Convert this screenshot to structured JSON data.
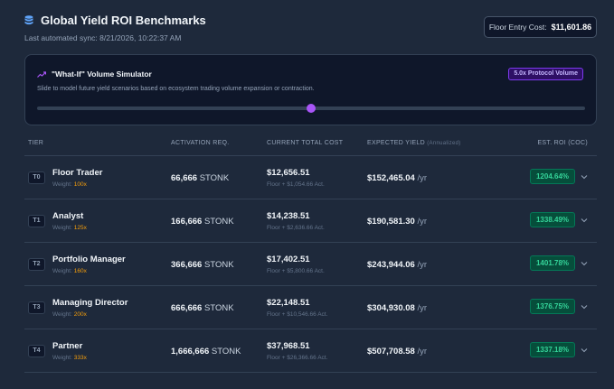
{
  "header": {
    "title": "Global Yield ROI Benchmarks",
    "sync": "Last automated sync: 8/21/2026, 10:22:37 AM"
  },
  "floor": {
    "label": "Floor Entry Cost:",
    "value": "$11,601.86"
  },
  "simulator": {
    "title": "\"What-If\" Volume Simulator",
    "description": "Slide to model future yield scenarios based on ecosystem trading volume expansion or contraction.",
    "badge": "5.0x Protocol Volume",
    "slider_fraction": 0.5
  },
  "table": {
    "headers": {
      "tier": "TIER",
      "activation": "ACTIVATION REQ.",
      "cost": "CURRENT TOTAL COST",
      "yield": "EXPECTED YIELD",
      "yield_sub": "(Annualized)",
      "roi": "EST. ROI (COC)"
    },
    "rows": [
      {
        "badge": "T0",
        "name": "Floor Trader",
        "weight_label": "Weight:",
        "weight": "100x",
        "activation": "66,666",
        "unit": "STONK",
        "cost": "$12,656.51",
        "cost_sub": "Floor + $1,054.66 Act.",
        "yield": "$152,465.04",
        "per": "/yr",
        "roi": "1204.64%"
      },
      {
        "badge": "T1",
        "name": "Analyst",
        "weight_label": "Weight:",
        "weight": "125x",
        "activation": "166,666",
        "unit": "STONK",
        "cost": "$14,238.51",
        "cost_sub": "Floor + $2,636.66 Act.",
        "yield": "$190,581.30",
        "per": "/yr",
        "roi": "1338.49%"
      },
      {
        "badge": "T2",
        "name": "Portfolio Manager",
        "weight_label": "Weight:",
        "weight": "160x",
        "activation": "366,666",
        "unit": "STONK",
        "cost": "$17,402.51",
        "cost_sub": "Floor + $5,800.66 Act.",
        "yield": "$243,944.06",
        "per": "/yr",
        "roi": "1401.78%"
      },
      {
        "badge": "T3",
        "name": "Managing Director",
        "weight_label": "Weight:",
        "weight": "200x",
        "activation": "666,666",
        "unit": "STONK",
        "cost": "$22,148.51",
        "cost_sub": "Floor + $10,546.66 Act.",
        "yield": "$304,930.08",
        "per": "/yr",
        "roi": "1376.75%"
      },
      {
        "badge": "T4",
        "name": "Partner",
        "weight_label": "Weight:",
        "weight": "333x",
        "activation": "1,666,666",
        "unit": "STONK",
        "cost": "$37,968.51",
        "cost_sub": "Floor + $26,366.66 Act.",
        "yield": "$507,708.58",
        "per": "/yr",
        "roi": "1337.18%"
      }
    ]
  },
  "colors": {
    "accent": "#a855f7",
    "roi": "#34d399",
    "weight": "#f59e0b",
    "icon": "#60a5fa"
  }
}
